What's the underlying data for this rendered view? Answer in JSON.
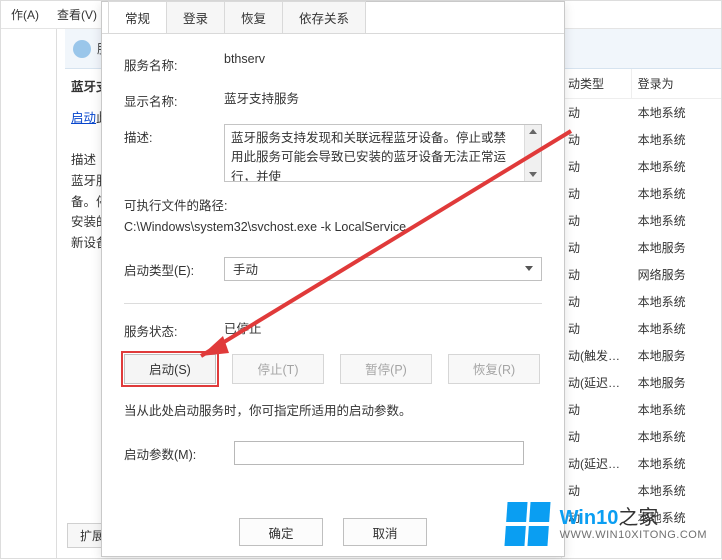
{
  "toolbar": {
    "menu_action": "作(A)",
    "menu_view": "查看(V)"
  },
  "svc_panel": {
    "bar_prefix": "服",
    "title": "蓝牙支",
    "link_prefix": "启动",
    "link_suffix": "此",
    "desc_label": "描述",
    "desc_body": "蓝牙服\n备。停\n安装的\n新设备"
  },
  "bottom_tab": "扩展",
  "columns": {
    "col_a": "动类型",
    "col_b": "登录为"
  },
  "rows": [
    {
      "a": "动",
      "b": "本地系统"
    },
    {
      "a": "动",
      "b": "本地系统"
    },
    {
      "a": "动",
      "b": "本地系统"
    },
    {
      "a": "动",
      "b": "本地系统"
    },
    {
      "a": "动",
      "b": "本地系统"
    },
    {
      "a": "动",
      "b": "本地服务"
    },
    {
      "a": "动",
      "b": "网络服务"
    },
    {
      "a": "动",
      "b": "本地系统"
    },
    {
      "a": "动",
      "b": "本地系统"
    },
    {
      "a": "动(触发…",
      "b": "本地服务"
    },
    {
      "a": "动(延迟…",
      "b": "本地服务"
    },
    {
      "a": "动",
      "b": "本地系统"
    },
    {
      "a": "动",
      "b": "本地系统"
    },
    {
      "a": "动(延迟…",
      "b": "本地系统"
    },
    {
      "a": "动",
      "b": "本地系统"
    },
    {
      "a": "动",
      "b": "本地系统"
    }
  ],
  "dialog": {
    "tabs": [
      "常规",
      "登录",
      "恢复",
      "依存关系"
    ],
    "svc_name_label": "服务名称:",
    "svc_name_value": "bthserv",
    "disp_name_label": "显示名称:",
    "disp_name_value": "蓝牙支持服务",
    "desc_label": "描述:",
    "desc_value": "蓝牙服务支持发现和关联远程蓝牙设备。停止或禁用此服务可能会导致已安装的蓝牙设备无法正常运行，并使",
    "path_label": "可执行文件的路径:",
    "path_value": "C:\\Windows\\system32\\svchost.exe -k LocalService",
    "startup_label": "启动类型(E):",
    "startup_value": "手动",
    "status_label": "服务状态:",
    "status_value": "已停止",
    "btn_start": "启动(S)",
    "btn_stop": "停止(T)",
    "btn_pause": "暂停(P)",
    "btn_resume": "恢复(R)",
    "info": "当从此处启动服务时，你可指定所适用的启动参数。",
    "param_label": "启动参数(M):",
    "ok": "确定",
    "cancel": "取消"
  },
  "wm": {
    "brand_a": "Win10",
    "brand_b": "之家",
    "url": "WWW.WIN10XITONG.COM"
  }
}
